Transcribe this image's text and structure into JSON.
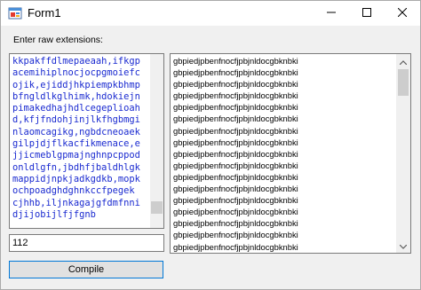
{
  "window": {
    "title": "Form1",
    "icons": {
      "app": "winforms-app-icon",
      "minimize": "minimize-icon",
      "maximize": "maximize-icon",
      "close": "close-icon"
    }
  },
  "form": {
    "prompt_label": "Enter raw extensions:",
    "extensions_lines": [
      "kkpakffdlmepaeaah,ifkgp",
      "acemihiplnocjocpgmoiefc",
      "ojik,ejiddjhkpiempkbhmp",
      "bfngldlkglhimk,hdokiejn",
      "pimakedhajhdlcegeplioah",
      "d,kfjfndohjinjlkfhgbmgi",
      "nlaomcagikg,ngbdcneoaek",
      "gilpjdjflkacfikmenace,e",
      "jjicmeblgpmajnghnpcppod",
      "onldlgfn,jbdhfjbaldhlgk",
      "mappidjnpkjadkgdkb,mopk",
      "ochpoadghdghnkccfpegek",
      "cjhhb,iljnkagajgfdmfnni",
      "djijobijlfjfgnb"
    ],
    "number_value": "112",
    "compile_label": "Compile",
    "output_items": [
      "gbpiedjpbenfnocfjpbjnldocgbknbki",
      "gbpiedjpbenfnocfjpbjnldocgbknbki",
      "gbpiedjpbenfnocfjpbjnldocgbknbki",
      "gbpiedjpbenfnocfjpbjnldocgbknbki",
      "gbpiedjpbenfnocfjpbjnldocgbknbki",
      "gbpiedjpbenfnocfjpbjnldocgbknbki",
      "gbpiedjpbenfnocfjpbjnldocgbknbki",
      "gbpiedjpbenfnocfjpbjnldocgbknbki",
      "gbpiedjpbenfnocfjpbjnldocgbknbki",
      "gbpiedjpbenfnocfjpbjnldocgbknbki",
      "gbpiedjpbenfnocfjpbjnldocgbknbki",
      "gbpiedjpbenfnocfjpbjnldocgbknbki",
      "gbpiedjpbenfnocfjpbjnldocgbknbki",
      "gbpiedjpbenfnocfjpbjnldocgbknbki",
      "gbpiedjpbenfnocfjpbjnldocgbknbki",
      "gbpiedjpbenfnocfjpbjnldocgbknbki",
      "gbpiedjpbenfnocfjpbjnldocgbknbki"
    ]
  },
  "colors": {
    "extensions_text": "#1a2ad0",
    "compile_border": "#0078d7",
    "window_bg": "#f0f0f0"
  }
}
